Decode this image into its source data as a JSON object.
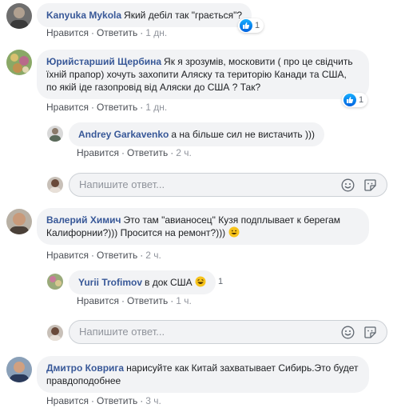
{
  "comments": [
    {
      "author": "Kanyuka Mykola",
      "text": "Який дебіл так \"грається\"?",
      "like_label": "Нравится",
      "reply_label": "Ответить",
      "time": "1 дн.",
      "reactions": "1"
    },
    {
      "author": "Юрийстарший Щербина",
      "text": "Як я зрозумів, московити ( про це свідчить їхній прапор) хочуть захопити Аляску та територію Канади та США, по якій іде газопровід від Аляски до США ? Так?",
      "like_label": "Нравится",
      "reply_label": "Ответить",
      "time": "1 дн.",
      "reactions": "1",
      "reply": {
        "author": "Andrey Garkavenko",
        "text": "а на більше сил не вистачить )))",
        "like_label": "Нравится",
        "reply_label": "Ответить",
        "time": "2 ч."
      }
    },
    {
      "author": "Валерий Химич",
      "text": "Это там \"авианосец\" Кузя подплывает к берегам Калифорнии?))) Просится на ремонт?)))",
      "like_label": "Нравится",
      "reply_label": "Ответить",
      "time": "2 ч.",
      "reply": {
        "author": "Yurii Trofimov",
        "text": "в док США",
        "reactions": "1",
        "like_label": "Нравится",
        "reply_label": "Ответить",
        "time": "1 ч."
      }
    },
    {
      "author": "Дмитро Коврига",
      "text": "нарисуйте как Китай захватывает Сибирь.Это будет правдоподобнее",
      "like_label": "Нравится",
      "reply_label": "Ответить",
      "time": "3 ч."
    }
  ],
  "reply_box": {
    "placeholder": "Напишите ответ..."
  },
  "icons": {
    "like": "thumbs-up-icon",
    "emoji": "smiley-icon",
    "sticker": "sticker-icon"
  },
  "colors": {
    "author": "#385898",
    "bubble": "#f2f3f5",
    "like_blue": "#1877f2"
  }
}
